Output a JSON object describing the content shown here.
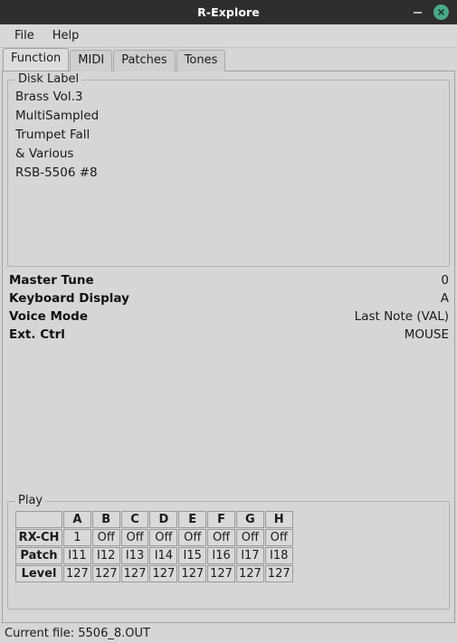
{
  "window": {
    "title": "R-Explore",
    "minimize_icon": "minimize-icon",
    "close_icon": "close-icon",
    "accent_close_color": "#4aa98b",
    "titlebar_color": "#2e2e2e",
    "background_color": "#d6d6d6"
  },
  "menubar": {
    "items": [
      {
        "label": "File"
      },
      {
        "label": "Help"
      }
    ]
  },
  "tabs": [
    {
      "label": "Function",
      "active": true
    },
    {
      "label": "MIDI",
      "active": false
    },
    {
      "label": "Patches",
      "active": false
    },
    {
      "label": "Tones",
      "active": false
    }
  ],
  "disk_label": {
    "legend": "Disk Label",
    "lines": [
      "Brass Vol.3",
      "MultiSampled",
      "Trumpet Fall",
      "& Various",
      "RSB-5506 #8"
    ]
  },
  "params": [
    {
      "label": "Master Tune",
      "value": "0"
    },
    {
      "label": "Keyboard Display",
      "value": "A"
    },
    {
      "label": "Voice Mode",
      "value": "Last Note (VAL)"
    },
    {
      "label": "Ext. Ctrl",
      "value": "MOUSE"
    }
  ],
  "play": {
    "legend": "Play",
    "corner": "",
    "columns": [
      "A",
      "B",
      "C",
      "D",
      "E",
      "F",
      "G",
      "H"
    ],
    "rows": [
      {
        "header": "RX-CH",
        "cells": [
          "1",
          "Off",
          "Off",
          "Off",
          "Off",
          "Off",
          "Off",
          "Off"
        ]
      },
      {
        "header": "Patch",
        "cells": [
          "I11",
          "I12",
          "I13",
          "I14",
          "I15",
          "I16",
          "I17",
          "I18"
        ]
      },
      {
        "header": "Level",
        "cells": [
          "127",
          "127",
          "127",
          "127",
          "127",
          "127",
          "127",
          "127"
        ]
      }
    ]
  },
  "statusbar": {
    "text": "Current file: 5506_8.OUT"
  }
}
